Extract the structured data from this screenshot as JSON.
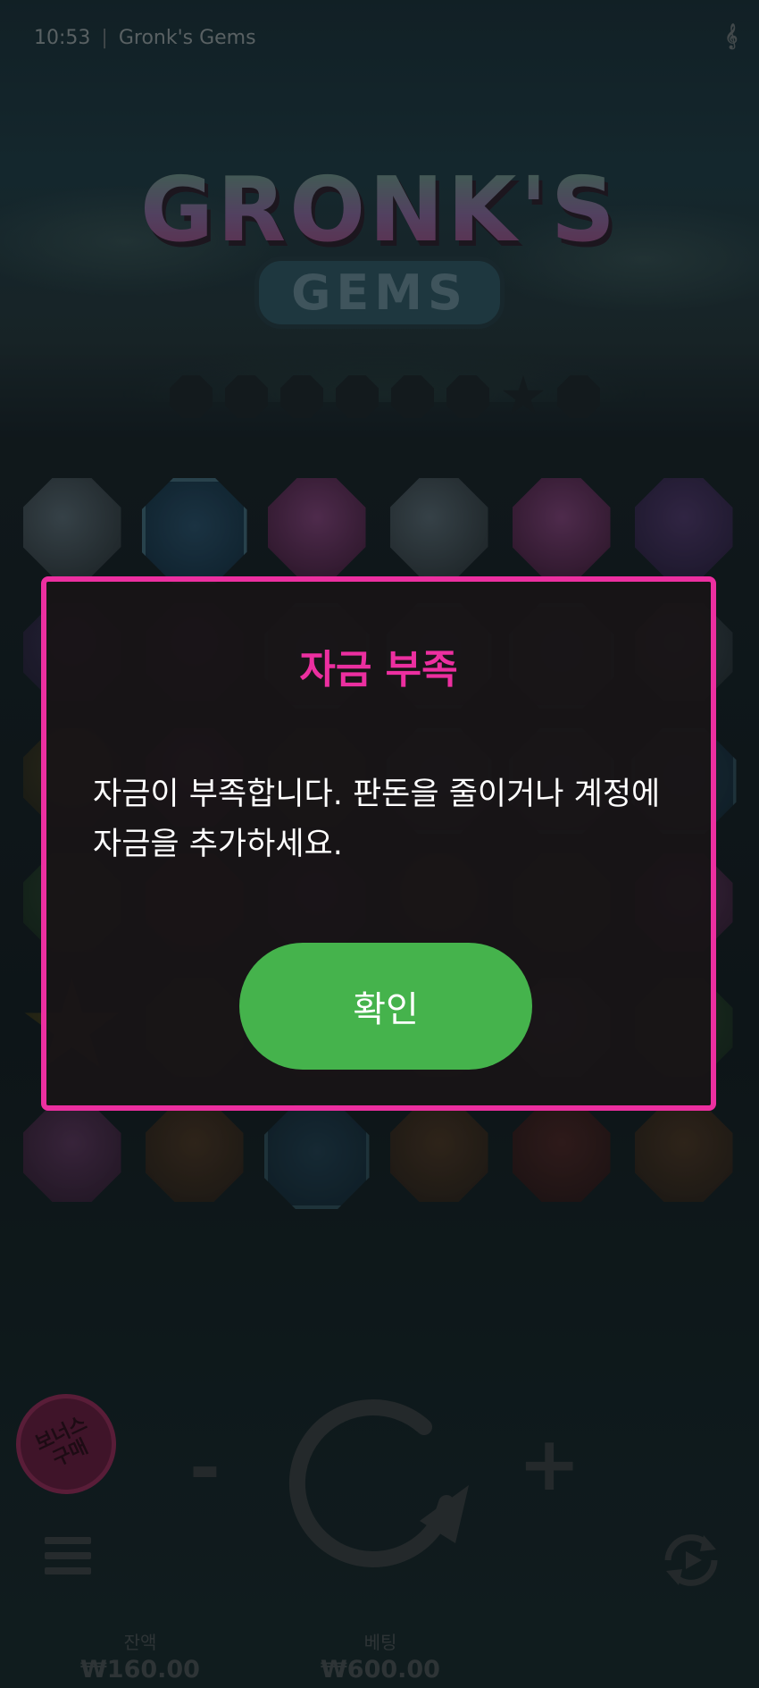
{
  "status_bar": {
    "time": "10:53",
    "app_title": "Gronk's Gems"
  },
  "logo": {
    "line1": "GRONK'S",
    "line2": "GEMS"
  },
  "progress_dots": {
    "icons": [
      "gem-slot-icon",
      "gem-slot-icon",
      "gem-slot-icon",
      "gem-slot-icon",
      "gem-slot-icon",
      "gem-slot-icon",
      "star-slot-icon",
      "gem-slot-icon"
    ]
  },
  "board": {
    "rows": [
      [
        "white",
        "blue",
        "pink",
        "white",
        "pink",
        "purple"
      ],
      [
        "purple",
        "purple",
        "blue",
        "blue",
        "blue",
        "white"
      ],
      [
        "gold",
        "pink",
        "green",
        "blue",
        "blue",
        "blue"
      ],
      [
        "green",
        "red",
        "purple",
        "gold",
        "green",
        "pink"
      ],
      [
        "yellow",
        "green",
        "red",
        "green",
        "white",
        "green"
      ],
      [
        "pink",
        "orange",
        "blue",
        "orange",
        "red",
        "orange"
      ]
    ]
  },
  "dialog": {
    "title": "자금 부족",
    "message": "자금이 부족합니다. 판돈을 줄이거나 계정에 자금을 추가하세요.",
    "confirm_label": "확인"
  },
  "controls": {
    "bonus_buy_label": "보너스 구매",
    "minus_label": "-",
    "plus_label": "+",
    "balance_label": "잔액",
    "balance_value": "₩160.00",
    "bet_label": "베팅",
    "bet_value": "₩600.00"
  },
  "colors": {
    "accent": "#ec2fa0",
    "confirm_button": "#45b34c",
    "background": "#101c1f"
  }
}
